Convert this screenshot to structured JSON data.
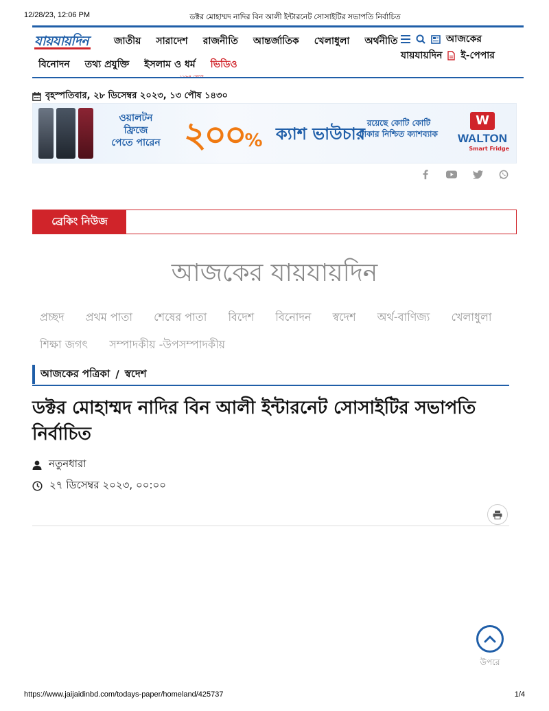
{
  "print": {
    "timestamp": "12/28/23, 12:06 PM",
    "page_title": "ডক্টর মোহাম্মদ নাদির বিন আলী ইন্টারনেট সোসাইটির সভাপতি নির্বাচিত",
    "url": "https://www.jaijaidinbd.com/todays-paper/homeland/425737",
    "page_number": "1/4"
  },
  "logo": {
    "text": "যায়যায়দিন"
  },
  "nav": {
    "row1": [
      "জাতীয়",
      "সারাদেশ",
      "রাজনীতি",
      "আন্তর্জাতিক",
      "খেলাধুলা",
      "অর্থনীতি"
    ],
    "row2": [
      "বিনোদন",
      "তথ্য প্রযুক্তি",
      "ইসলাম ও ধর্ম"
    ],
    "video": "ভিডিও",
    "todays_paper_line1": "আজকের",
    "todays_paper_line2": "যায়যায়দিন",
    "epaper": "ই-পেপার"
  },
  "masthead_stub": "১৯৮৪ থেকে",
  "date_line": "বৃহস্পতিবার, ২৮ ডিসেম্বর ২০২৩, ১৩ পৌষ ১৪৩০",
  "banner": {
    "left_text_1": "ওয়ালটন",
    "left_text_2": "ফ্রিজে",
    "left_text_3": "পেতে পারেন",
    "percent": "২০০",
    "percent_sign": "%",
    "middle": "ক্যাশ ভাউচার",
    "right_1": "রয়েছে কোটি কোটি",
    "right_2": "টাকার নিশ্চিত ক্যাশব্যাক",
    "brand": "WALTON",
    "brand_sub": "Smart Fridge",
    "brand_mark": "W"
  },
  "breaking": {
    "label": "ব্রেকিং নিউজ"
  },
  "paper": {
    "title": "আজকের যায়যায়দিন",
    "sections": [
      "প্রচ্ছদ",
      "প্রথম পাতা",
      "শেষের পাতা",
      "বিদেশ",
      "বিনোদন",
      "স্বদেশ",
      "অর্থ-বাণিজ্য",
      "খেলাধুলা",
      "শিক্ষা জগৎ",
      "সম্পাদকীয় -উপসম্পাদকীয়"
    ]
  },
  "breadcrumb": {
    "parent": "আজকের পত্রিকা",
    "separator": "/",
    "current": "স্বদেশ"
  },
  "article": {
    "headline": "ডক্টর মোহাম্মদ নাদির বিন আলী ইন্টারনেট সোসাইটির সভাপতি নির্বাচিত",
    "author": "নতুনধারা",
    "published": "২৭ ডিসেম্বর ২০২৩, ০০:০০"
  },
  "back_to_top": {
    "label": "উপরে"
  },
  "colors": {
    "brand_blue": "#1f5ea8",
    "brand_red": "#d0242a"
  }
}
